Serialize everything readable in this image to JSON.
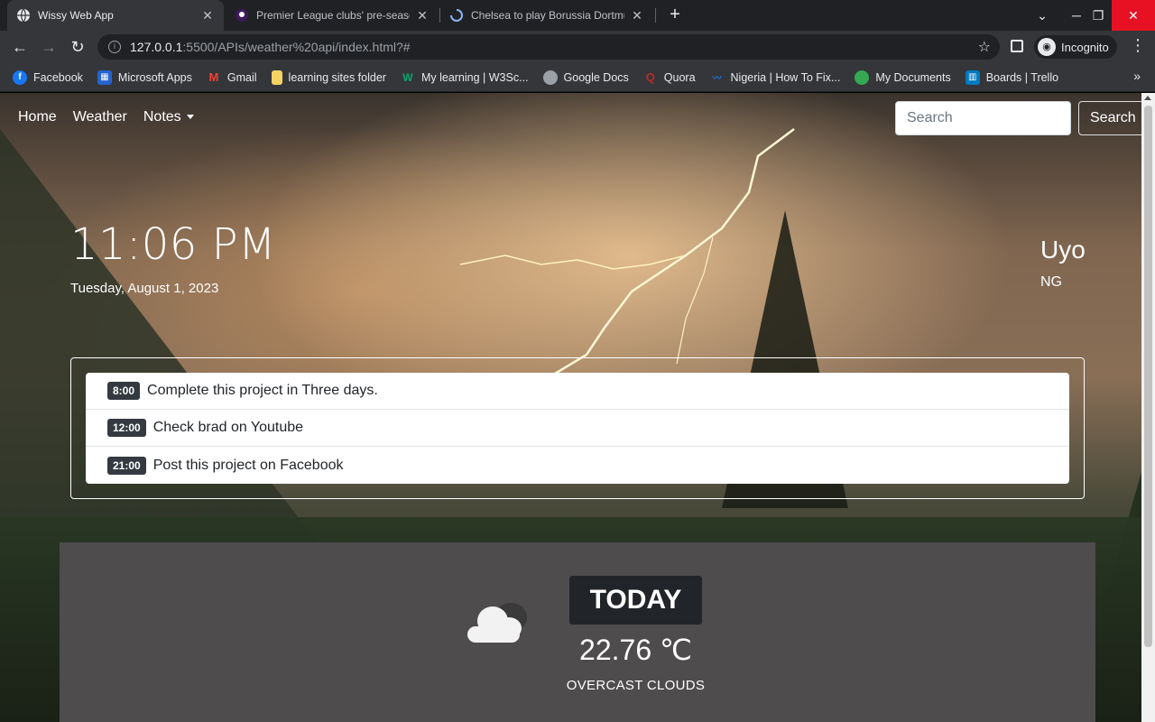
{
  "browser": {
    "tabs": [
      {
        "title": "Wissy Web App",
        "active": true
      },
      {
        "title": "Premier League clubs' pre-season",
        "active": false
      },
      {
        "title": "Chelsea to play Borussia Dortmund",
        "active": false
      }
    ],
    "url_host": "127.0.0.1",
    "url_rest": ":5500/APIs/weather%20api/index.html?#",
    "incognito_label": "Incognito",
    "bookmarks": [
      {
        "label": "Facebook",
        "icon": "facebook-icon",
        "color": "#1877f2"
      },
      {
        "label": "Microsoft Apps",
        "icon": "microsoft-icon",
        "color": "#2564cf"
      },
      {
        "label": "Gmail",
        "icon": "gmail-icon",
        "color": "#ea4335"
      },
      {
        "label": "learning sites folder",
        "icon": "folder-icon",
        "color": "#f6d365"
      },
      {
        "label": "My learning | W3Sc...",
        "icon": "w3schools-icon",
        "color": "#04aa6d"
      },
      {
        "label": "Google Docs",
        "icon": "globe-icon",
        "color": "#9aa0a6"
      },
      {
        "label": "Quora",
        "icon": "quora-icon",
        "color": "#b92b27"
      },
      {
        "label": "Nigeria | How To Fix...",
        "icon": "nigeria-site-icon",
        "color": "#1a73e8"
      },
      {
        "label": "My Documents",
        "icon": "documents-icon",
        "color": "#34a853"
      },
      {
        "label": "Boards | Trello",
        "icon": "trello-icon",
        "color": "#0079bf"
      }
    ]
  },
  "nav": {
    "home": "Home",
    "weather": "Weather",
    "notes": "Notes",
    "search_placeholder": "Search",
    "search_button": "Search"
  },
  "clock": {
    "time": "11:06 PM",
    "date": "Tuesday, August 1, 2023"
  },
  "location": {
    "city": "Uyo",
    "country": "NG"
  },
  "notes": [
    {
      "time": "8:00",
      "text": "Complete this project in Three days."
    },
    {
      "time": "12:00",
      "text": "Check brad on Youtube"
    },
    {
      "time": "21:00",
      "text": "Post this project on Facebook"
    }
  ],
  "weather": {
    "label": "TODAY",
    "temperature": "22.76 ℃",
    "description": "OVERCAST CLOUDS",
    "icon": "cloud-icon"
  }
}
